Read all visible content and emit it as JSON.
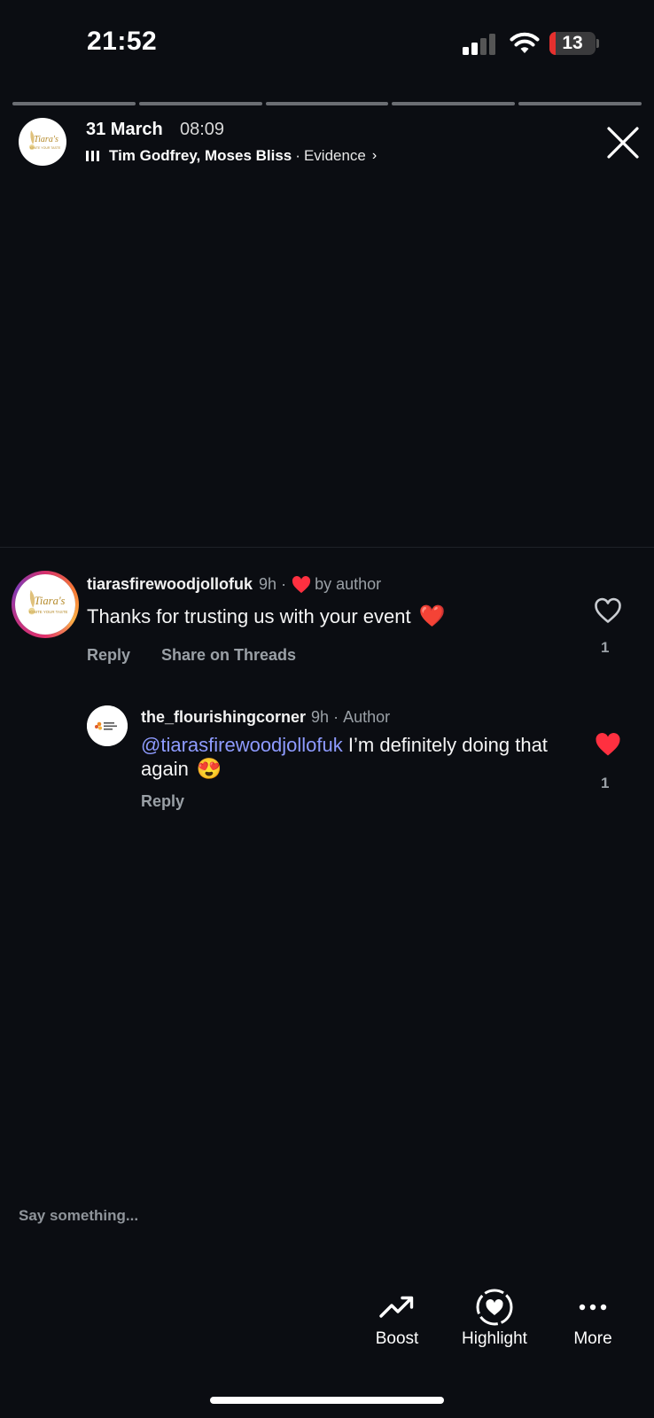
{
  "status_bar": {
    "time": "21:52",
    "battery": "13",
    "battery_level": 0.13,
    "signal_bars_active": 2,
    "icons": [
      "cellular-signal-icon",
      "wifi-icon",
      "battery-icon"
    ]
  },
  "story": {
    "progress_segments": 5,
    "date": "31 March",
    "time": "08:09",
    "music": {
      "artist": "Tim Godfrey, Moses Bliss",
      "separator": "·",
      "song": "Evidence",
      "chevron": "›"
    },
    "avatar_text": "Tiara's",
    "avatar_tagline": "IGNITE YOUR TASTE"
  },
  "comments": [
    {
      "username": "tiarasfirewoodjollofuk",
      "time": "9h",
      "dot": "·",
      "liked_by": "by author",
      "text": "Thanks for trusting us with your event",
      "emoji": "❤️",
      "reply_label": "Reply",
      "share_label": "Share on Threads",
      "likes": "1",
      "liked": false
    },
    {
      "username": "the_flourishingcorner",
      "time": "9h",
      "dot": "·",
      "badge": "Author",
      "mention": "@tiarasfirewoodjollofuk",
      "text": " I’m definitely doing that again",
      "emoji": "😍",
      "reply_label": "Reply",
      "likes": "1",
      "liked": true,
      "avatar_text": "The Flourishing Corner"
    }
  ],
  "input": {
    "placeholder": "Say something..."
  },
  "bottom_actions": [
    {
      "label": "Boost",
      "icon": "trending-up-icon"
    },
    {
      "label": "Highlight",
      "icon": "highlight-heart-icon"
    },
    {
      "label": "More",
      "icon": "more-dots-icon"
    }
  ],
  "colors": {
    "background": "#0b0d12",
    "mention": "#8e9bff",
    "like_red": "#ff3040",
    "battery_red": "#e5302e"
  }
}
